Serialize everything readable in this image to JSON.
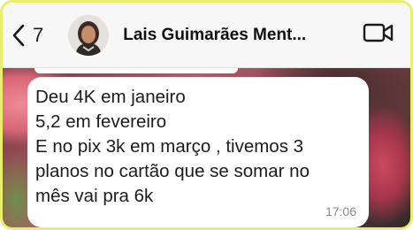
{
  "header": {
    "back_count": "7",
    "contact_name": "Lais Guimarães Ment...",
    "icons": {
      "back": "chevron-left-icon",
      "video": "video-camera-icon"
    }
  },
  "message": {
    "text": "Deu 4K em janeiro\n5,2 em fevereiro\nE no pix 3k em março , tivemos 3\nplanos no cartão que se somar no\nmês vai pra 6k",
    "time": "17:06"
  }
}
